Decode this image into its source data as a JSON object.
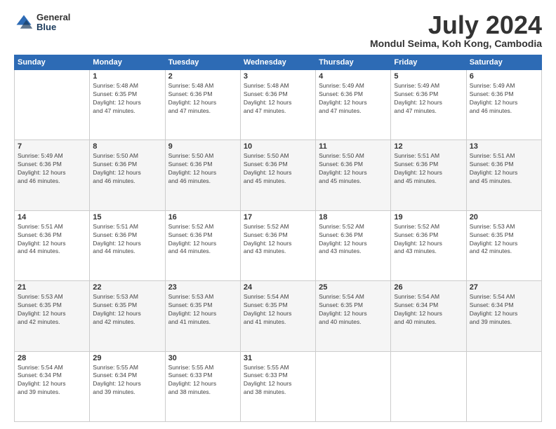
{
  "header": {
    "logo_line1": "General",
    "logo_line2": "Blue",
    "main_title": "July 2024",
    "subtitle": "Mondul Seima, Koh Kong, Cambodia"
  },
  "days_of_week": [
    "Sunday",
    "Monday",
    "Tuesday",
    "Wednesday",
    "Thursday",
    "Friday",
    "Saturday"
  ],
  "weeks": [
    [
      {
        "day": "",
        "info": ""
      },
      {
        "day": "1",
        "info": "Sunrise: 5:48 AM\nSunset: 6:35 PM\nDaylight: 12 hours\nand 47 minutes."
      },
      {
        "day": "2",
        "info": "Sunrise: 5:48 AM\nSunset: 6:36 PM\nDaylight: 12 hours\nand 47 minutes."
      },
      {
        "day": "3",
        "info": "Sunrise: 5:48 AM\nSunset: 6:36 PM\nDaylight: 12 hours\nand 47 minutes."
      },
      {
        "day": "4",
        "info": "Sunrise: 5:49 AM\nSunset: 6:36 PM\nDaylight: 12 hours\nand 47 minutes."
      },
      {
        "day": "5",
        "info": "Sunrise: 5:49 AM\nSunset: 6:36 PM\nDaylight: 12 hours\nand 47 minutes."
      },
      {
        "day": "6",
        "info": "Sunrise: 5:49 AM\nSunset: 6:36 PM\nDaylight: 12 hours\nand 46 minutes."
      }
    ],
    [
      {
        "day": "7",
        "info": "Sunrise: 5:49 AM\nSunset: 6:36 PM\nDaylight: 12 hours\nand 46 minutes."
      },
      {
        "day": "8",
        "info": "Sunrise: 5:50 AM\nSunset: 6:36 PM\nDaylight: 12 hours\nand 46 minutes."
      },
      {
        "day": "9",
        "info": "Sunrise: 5:50 AM\nSunset: 6:36 PM\nDaylight: 12 hours\nand 46 minutes."
      },
      {
        "day": "10",
        "info": "Sunrise: 5:50 AM\nSunset: 6:36 PM\nDaylight: 12 hours\nand 45 minutes."
      },
      {
        "day": "11",
        "info": "Sunrise: 5:50 AM\nSunset: 6:36 PM\nDaylight: 12 hours\nand 45 minutes."
      },
      {
        "day": "12",
        "info": "Sunrise: 5:51 AM\nSunset: 6:36 PM\nDaylight: 12 hours\nand 45 minutes."
      },
      {
        "day": "13",
        "info": "Sunrise: 5:51 AM\nSunset: 6:36 PM\nDaylight: 12 hours\nand 45 minutes."
      }
    ],
    [
      {
        "day": "14",
        "info": "Sunrise: 5:51 AM\nSunset: 6:36 PM\nDaylight: 12 hours\nand 44 minutes."
      },
      {
        "day": "15",
        "info": "Sunrise: 5:51 AM\nSunset: 6:36 PM\nDaylight: 12 hours\nand 44 minutes."
      },
      {
        "day": "16",
        "info": "Sunrise: 5:52 AM\nSunset: 6:36 PM\nDaylight: 12 hours\nand 44 minutes."
      },
      {
        "day": "17",
        "info": "Sunrise: 5:52 AM\nSunset: 6:36 PM\nDaylight: 12 hours\nand 43 minutes."
      },
      {
        "day": "18",
        "info": "Sunrise: 5:52 AM\nSunset: 6:36 PM\nDaylight: 12 hours\nand 43 minutes."
      },
      {
        "day": "19",
        "info": "Sunrise: 5:52 AM\nSunset: 6:36 PM\nDaylight: 12 hours\nand 43 minutes."
      },
      {
        "day": "20",
        "info": "Sunrise: 5:53 AM\nSunset: 6:35 PM\nDaylight: 12 hours\nand 42 minutes."
      }
    ],
    [
      {
        "day": "21",
        "info": "Sunrise: 5:53 AM\nSunset: 6:35 PM\nDaylight: 12 hours\nand 42 minutes."
      },
      {
        "day": "22",
        "info": "Sunrise: 5:53 AM\nSunset: 6:35 PM\nDaylight: 12 hours\nand 42 minutes."
      },
      {
        "day": "23",
        "info": "Sunrise: 5:53 AM\nSunset: 6:35 PM\nDaylight: 12 hours\nand 41 minutes."
      },
      {
        "day": "24",
        "info": "Sunrise: 5:54 AM\nSunset: 6:35 PM\nDaylight: 12 hours\nand 41 minutes."
      },
      {
        "day": "25",
        "info": "Sunrise: 5:54 AM\nSunset: 6:35 PM\nDaylight: 12 hours\nand 40 minutes."
      },
      {
        "day": "26",
        "info": "Sunrise: 5:54 AM\nSunset: 6:34 PM\nDaylight: 12 hours\nand 40 minutes."
      },
      {
        "day": "27",
        "info": "Sunrise: 5:54 AM\nSunset: 6:34 PM\nDaylight: 12 hours\nand 39 minutes."
      }
    ],
    [
      {
        "day": "28",
        "info": "Sunrise: 5:54 AM\nSunset: 6:34 PM\nDaylight: 12 hours\nand 39 minutes."
      },
      {
        "day": "29",
        "info": "Sunrise: 5:55 AM\nSunset: 6:34 PM\nDaylight: 12 hours\nand 39 minutes."
      },
      {
        "day": "30",
        "info": "Sunrise: 5:55 AM\nSunset: 6:33 PM\nDaylight: 12 hours\nand 38 minutes."
      },
      {
        "day": "31",
        "info": "Sunrise: 5:55 AM\nSunset: 6:33 PM\nDaylight: 12 hours\nand 38 minutes."
      },
      {
        "day": "",
        "info": ""
      },
      {
        "day": "",
        "info": ""
      },
      {
        "day": "",
        "info": ""
      }
    ]
  ]
}
